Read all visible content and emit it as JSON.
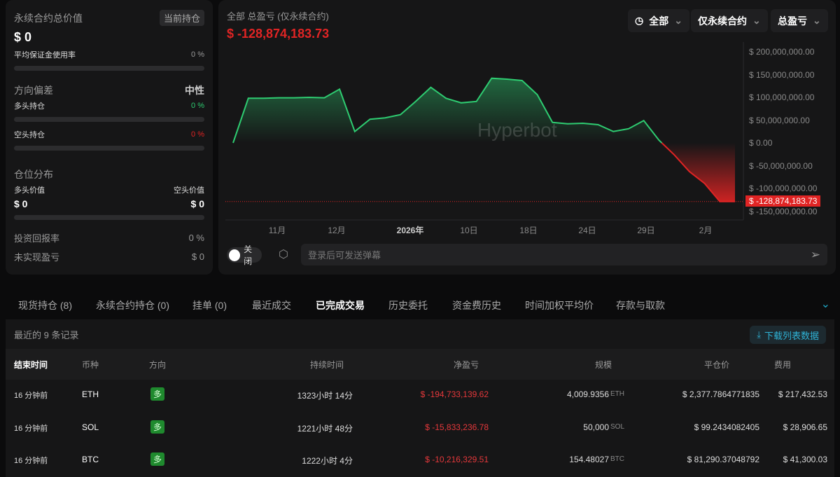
{
  "left": {
    "title": "永续合约总价值",
    "tag": "当前持仓",
    "total": "$ 0",
    "margin_label": "平均保证金使用率",
    "margin_value": "0 %",
    "bias_label": "方向偏差",
    "bias_value": "中性",
    "long_label": "多头持仓",
    "long_value": "0 %",
    "short_label": "空头持仓",
    "short_value": "0 %",
    "dist_label": "仓位分布",
    "long_val_label": "多头价值",
    "short_val_label": "空头价值",
    "long_val": "$ 0",
    "short_val": "$ 0",
    "roi_label": "投资回报率",
    "roi_value": "0 %",
    "upnl_label": "未实现盈亏",
    "upnl_value": "$ 0"
  },
  "main": {
    "title": "全部 总盈亏 (仅永续合约)",
    "pnl": "$ -128,874,183.73",
    "dd_range": "全部",
    "dd_type": "仅永续合约",
    "dd_metric": "总盈亏",
    "watermark": "Hyperbot",
    "toggle_label": "关闭",
    "chat_placeholder": "登录后可发送弹幕"
  },
  "chart_data": {
    "type": "area",
    "ylim": [
      -150000000,
      200000000
    ],
    "yticks": [
      "$ 200,000,000.00",
      "$ 150,000,000.00",
      "$ 100,000,000.00",
      "$ 50,000,000.00",
      "$ 0.00",
      "$ -50,000,000.00",
      "$ -100,000,000.00",
      "$ -150,000,000.00"
    ],
    "xticks": [
      "11月",
      "12月",
      "2026年",
      "10日",
      "18日",
      "24日",
      "29日",
      "2月"
    ],
    "last_label": "$ -128,874,183.73",
    "values": [
      0,
      98000000,
      98000000,
      99000000,
      99000000,
      100000000,
      99000000,
      118000000,
      25000000,
      52000000,
      55000000,
      62000000,
      91000000,
      122000000,
      98000000,
      88000000,
      91000000,
      142000000,
      140000000,
      137000000,
      106000000,
      45000000,
      42000000,
      43000000,
      40000000,
      25000000,
      31000000,
      49000000,
      6000000,
      -26000000,
      -63000000,
      -89000000,
      -128874183.73,
      -128874183.73
    ],
    "colors": {
      "up": "#2ecc71",
      "down": "#e02424"
    }
  },
  "tabs": [
    "现货持仓 (8)",
    "永续合约持仓 (0)",
    "挂单 (0)",
    "最近成交",
    "已完成交易",
    "历史委托",
    "资金费历史",
    "时间加权平均价",
    "存款与取款"
  ],
  "table": {
    "count": "最近的 9 条记录",
    "download": "下载列表数据",
    "headers": [
      "结束时间",
      "币种",
      "方向",
      "持续时间",
      "净盈亏",
      "规模",
      "平仓价",
      "费用"
    ],
    "rows": [
      [
        "16 分钟前",
        "ETH",
        "多",
        "1323小时 14分",
        "$ -194,733,139.62",
        "4,009.9356",
        "ETH",
        "$ 2,377.7864771835",
        "$ 217,432.53"
      ],
      [
        "16 分钟前",
        "SOL",
        "多",
        "1221小时 48分",
        "$ -15,833,236.78",
        "50,000",
        "SOL",
        "$ 99.2434082405",
        "$ 28,906.65"
      ],
      [
        "16 分钟前",
        "BTC",
        "多",
        "1222小时 4分",
        "$ -10,216,329.51",
        "154.48027",
        "BTC",
        "$ 81,290.37048792",
        "$ 41,300.03"
      ]
    ]
  }
}
